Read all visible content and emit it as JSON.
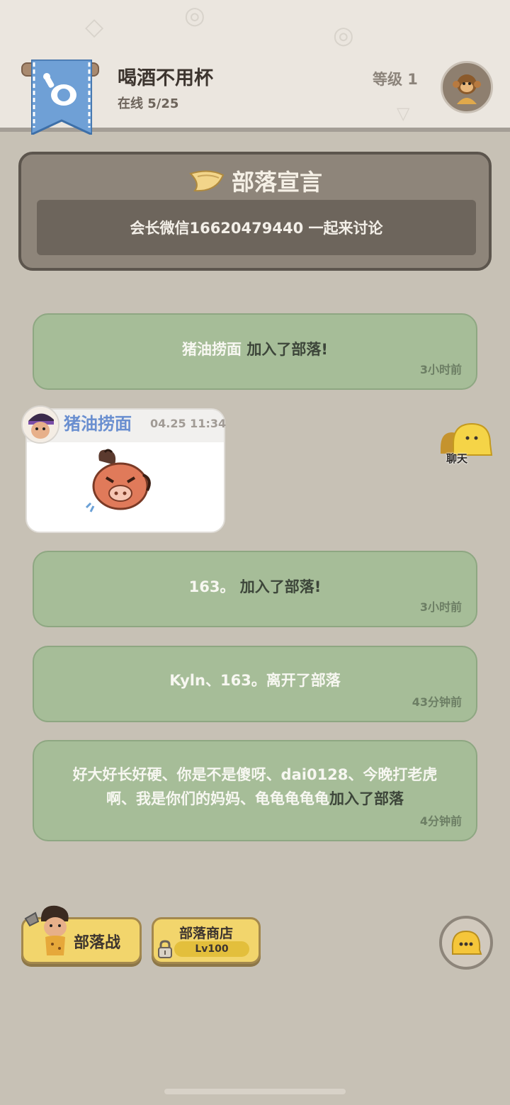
{
  "header": {
    "tribe_name": "喝酒不用杯",
    "online": "在线 5/25",
    "level": "等级 1"
  },
  "manifesto": {
    "title": "部落宣言",
    "body": "会长微信16620479440 一起来讨论"
  },
  "messages": [
    {
      "name": "猪油捞面",
      "action": " 加入了部落!",
      "time": "3小时前"
    },
    {
      "name": "163。",
      "action": " 加入了部落!",
      "time": "3小时前"
    },
    {
      "name": "Kyln、163。",
      "action": "离开了部落",
      "time": "43分钟前"
    },
    {
      "line1": "好大好长好硬、你是不是傻呀、dai0128、今晚打老虎",
      "line2_names": "啊、我是你们的妈妈、龟龟龟龟龟",
      "action": "加入了部落",
      "time": "4分钟前"
    }
  ],
  "chat": {
    "sender": "猪油捞面",
    "time": "04.25 11:34",
    "side_label": "聊天"
  },
  "bottom": {
    "war_label": "部落战",
    "shop_label": "部落商店",
    "shop_level": "Lv100"
  }
}
